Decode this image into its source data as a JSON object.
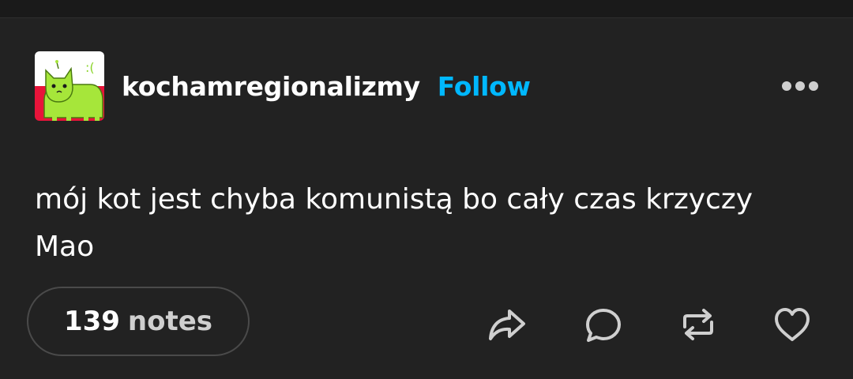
{
  "post": {
    "username": "kochamregionalizmy",
    "follow_label": "Follow",
    "text": "mój kot jest chyba komunistą bo cały czas krzyczy Mao",
    "notes_count": "139",
    "notes_label": "notes"
  },
  "avatar": {
    "face_text": ":(",
    "colors": {
      "flag_white": "#ffffff",
      "flag_red": "#e8143a",
      "cat": "#a6e63a"
    }
  },
  "icons": {
    "more": "more-options-icon",
    "share": "share-icon",
    "reply": "reply-icon",
    "reblog": "reblog-icon",
    "like": "heart-icon"
  },
  "colors": {
    "background": "#222222",
    "accent": "#00b8ff",
    "text": "#ffffff",
    "icon": "#cfcfcf"
  }
}
